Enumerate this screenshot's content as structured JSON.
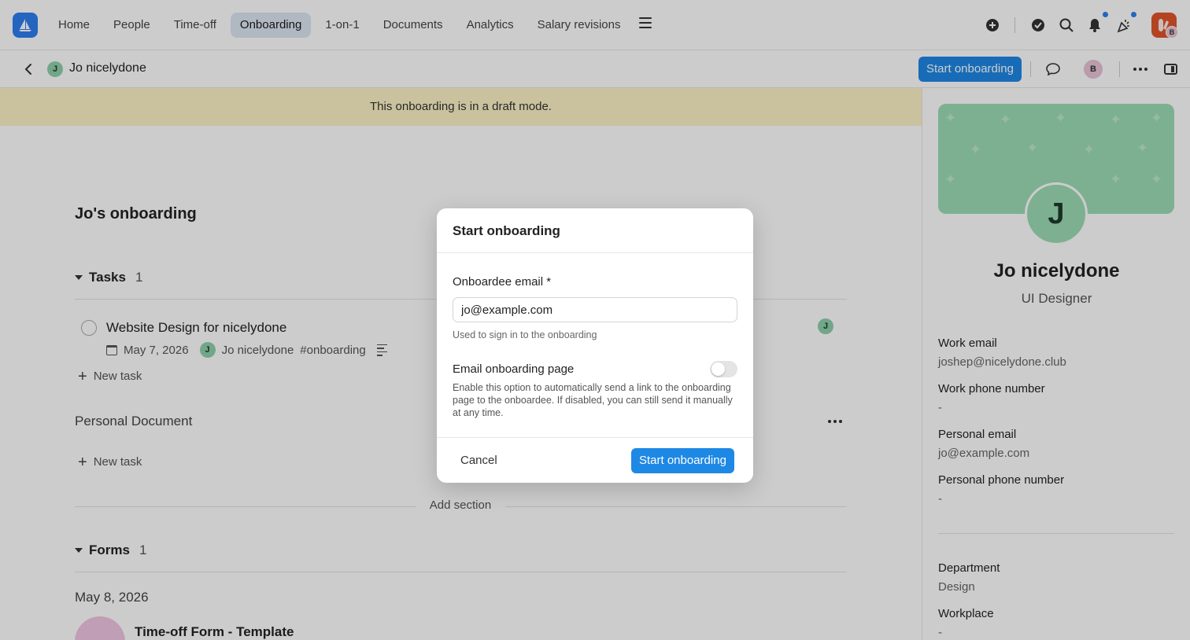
{
  "nav": {
    "items": [
      "Home",
      "People",
      "Time-off",
      "Onboarding",
      "1-on-1",
      "Documents",
      "Analytics",
      "Salary revisions"
    ],
    "active": "Onboarding"
  },
  "subheader": {
    "person_initial": "J",
    "person_name": "Jo nicelydone",
    "start_button": "Start onboarding",
    "user_initial": "B"
  },
  "banner": {
    "text": "This onboarding is in a draft mode."
  },
  "main": {
    "title": "Jo's onboarding",
    "tasks_section": {
      "label": "Tasks",
      "count": "1"
    },
    "task": {
      "title": "Website Design for nicelydone",
      "date": "May 7, 2026",
      "assignee_initial": "J",
      "assignee": "Jo nicelydone",
      "tag": "#onboarding"
    },
    "new_task": "New task",
    "personal_document": "Personal Document",
    "add_section": "Add section",
    "forms_section": {
      "label": "Forms",
      "count": "1"
    },
    "forms_date": "May 8, 2026",
    "form_title": "Time-off Form - Template"
  },
  "profile": {
    "initial": "J",
    "name": "Jo nicelydone",
    "role": "UI Designer",
    "fields": [
      {
        "label": "Work email",
        "value": "joshep@nicelydone.club"
      },
      {
        "label": "Work phone number",
        "value": "-"
      },
      {
        "label": "Personal email",
        "value": "jo@example.com"
      },
      {
        "label": "Personal phone number",
        "value": "-"
      },
      {
        "label": "Department",
        "value": "Design"
      },
      {
        "label": "Workplace",
        "value": "-"
      }
    ]
  },
  "modal": {
    "title": "Start onboarding",
    "email_label": "Onboardee email *",
    "email_value": "jo@example.com",
    "email_help": "Used to sign in to the onboarding",
    "toggle_label": "Email onboarding page",
    "toggle_on": false,
    "toggle_desc": "Enable this option to automatically send a link to the onboarding page to the onboardee. If disabled, you can still send it manually at any time.",
    "cancel": "Cancel",
    "confirm": "Start onboarding"
  },
  "colors": {
    "primary": "#1e88e5",
    "banner": "#fdf3c6",
    "avatar_green": "#9ddcb6",
    "badge_blue": "#2d7ff0"
  }
}
